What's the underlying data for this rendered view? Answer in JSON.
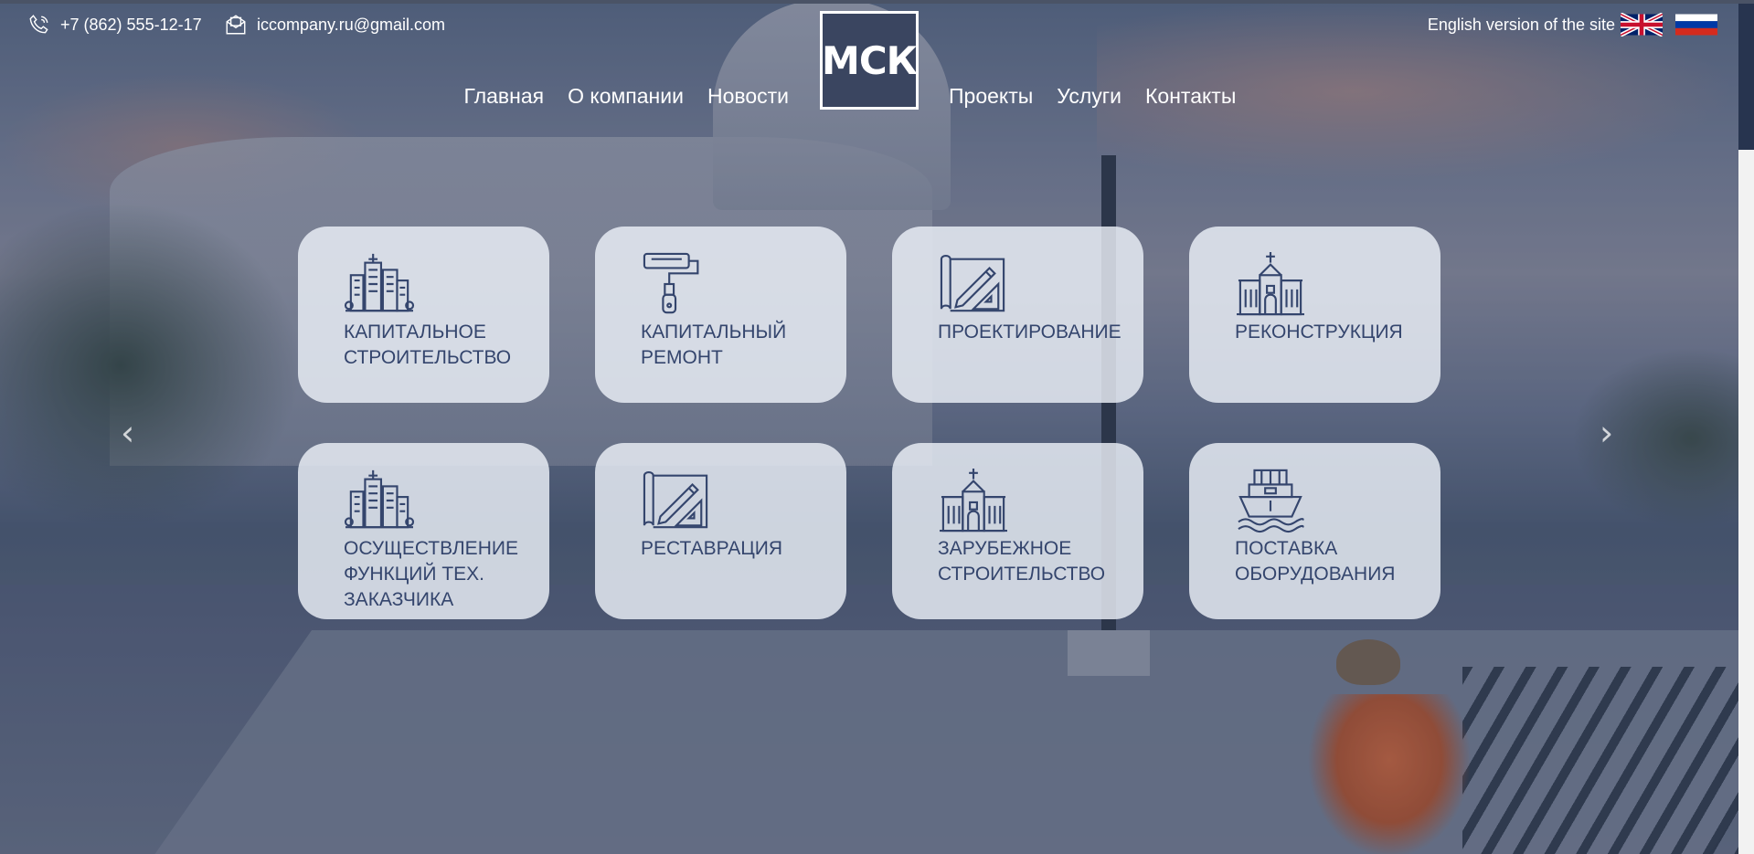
{
  "header": {
    "phone": "+7 (862) 555-12-17",
    "email": "iccompany.ru@gmail.com",
    "english_link": "English version of the site",
    "logo_text": "МСК",
    "icons": {
      "phone": "phone-icon",
      "email": "envelope-icon",
      "flag_en": "uk-flag-icon",
      "flag_ru": "ru-flag-icon"
    }
  },
  "nav": {
    "left": [
      "Главная",
      "О компании",
      "Новости"
    ],
    "right": [
      "Проекты",
      "Услуги",
      "Контакты"
    ]
  },
  "services": [
    {
      "label": "Капитальное строительство",
      "icon": "city-buildings-icon"
    },
    {
      "label": "Капитальный ремонт",
      "icon": "paint-roller-icon"
    },
    {
      "label": "Проектирование",
      "icon": "blueprint-pencil-icon"
    },
    {
      "label": "Реконструкция",
      "icon": "church-icon"
    },
    {
      "label": "Осуществление функций тех. заказчика",
      "icon": "city-buildings-icon"
    },
    {
      "label": "Реставрация",
      "icon": "blueprint-pencil-icon"
    },
    {
      "label": "Зарубежное строительство",
      "icon": "church-icon"
    },
    {
      "label": "Поставка оборудования",
      "icon": "cargo-ship-icon"
    }
  ],
  "carousel": {
    "prev_icon": "chevron-left-icon",
    "next_icon": "chevron-right-icon"
  },
  "colors": {
    "tile_text": "#34456d",
    "logo_bg": "#3a4560",
    "tile_bg": "#ecf0f8"
  }
}
